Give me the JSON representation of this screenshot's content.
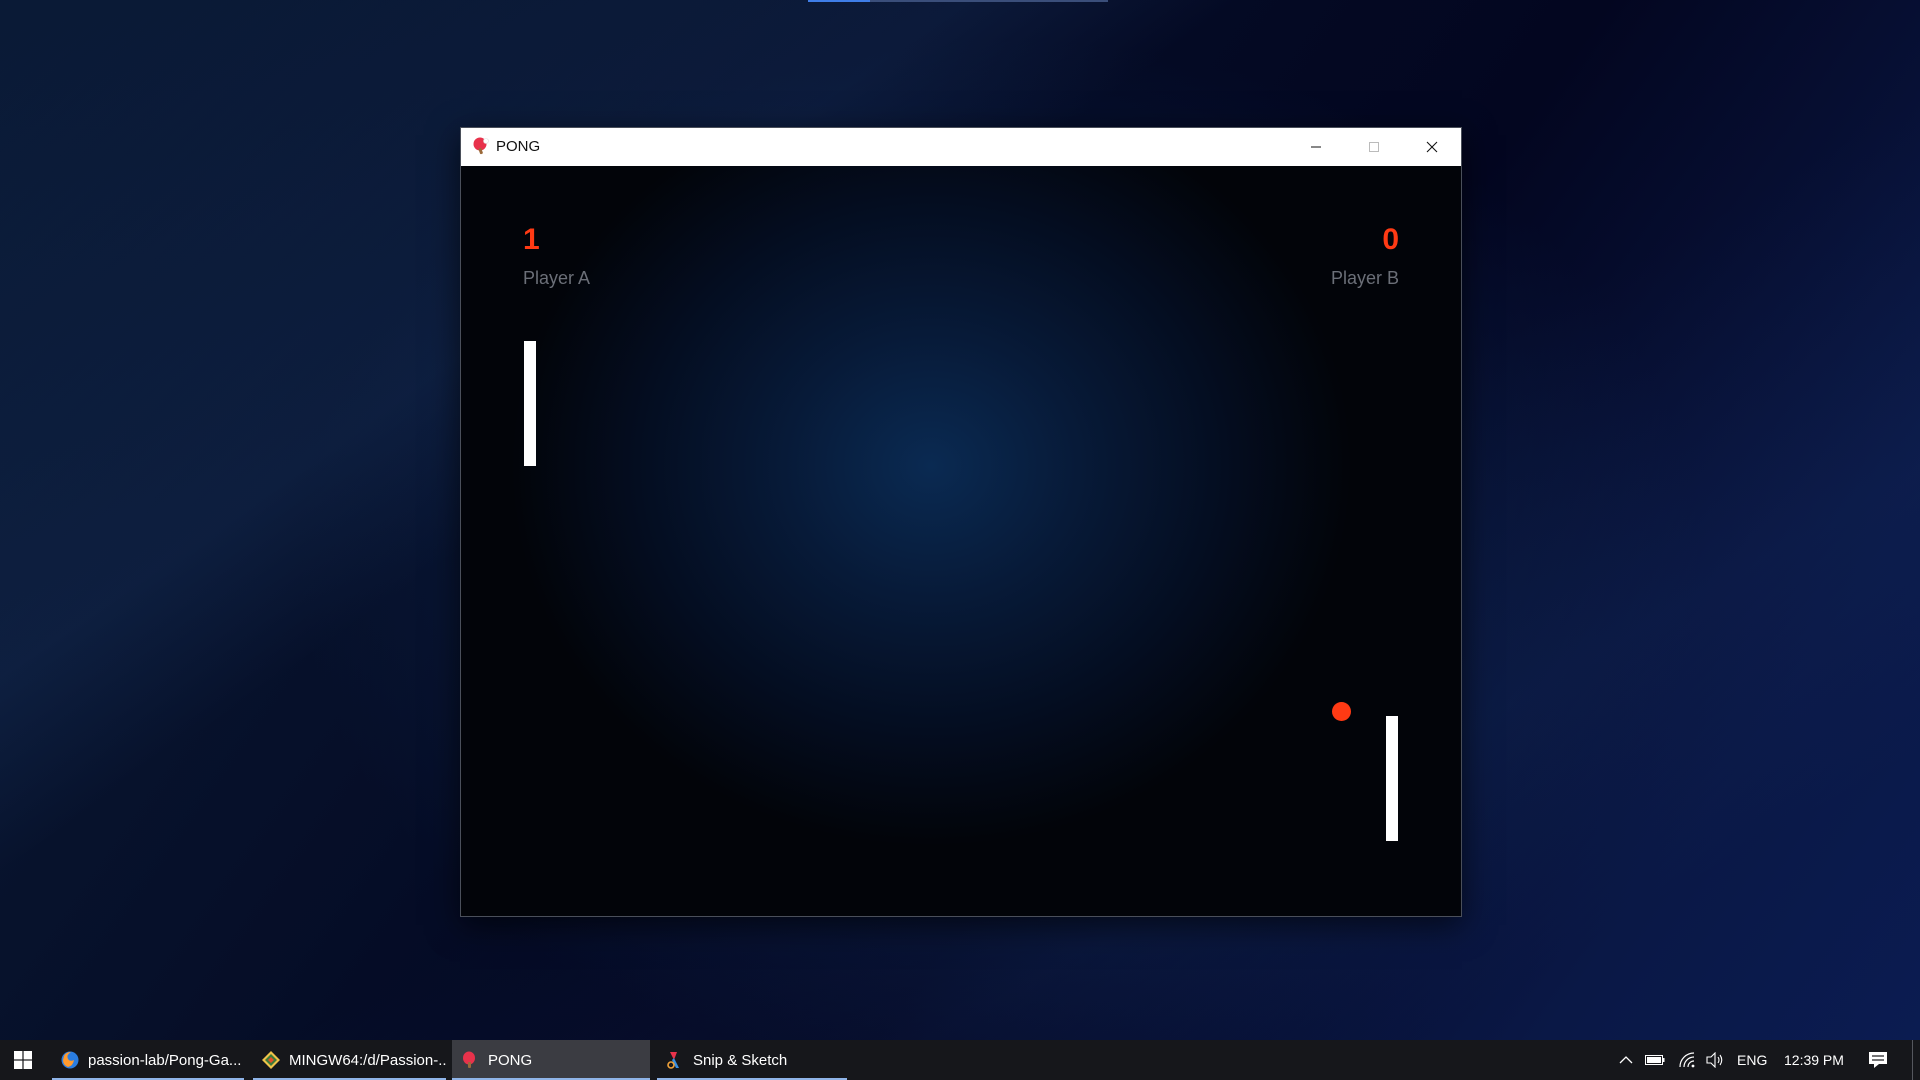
{
  "window": {
    "title": "PONG"
  },
  "game": {
    "player_a": {
      "score": "1",
      "label": "Player A"
    },
    "player_b": {
      "score": "0",
      "label": "Player B"
    },
    "colors": {
      "score": "#ff3a14",
      "ball": "#ff3a14",
      "paddle": "#ffffff",
      "label": "#6b6f78"
    }
  },
  "taskbar": {
    "items": [
      {
        "label": "passion-lab/Pong-Ga...",
        "icon": "firefox-icon"
      },
      {
        "label": "MINGW64:/d/Passion-...",
        "icon": "git-bash-icon"
      },
      {
        "label": "PONG",
        "icon": "pong-icon",
        "active": true
      },
      {
        "label": "Snip & Sketch",
        "icon": "snip-sketch-icon"
      }
    ],
    "tray": {
      "language": "ENG",
      "time": "12:39 PM"
    }
  }
}
